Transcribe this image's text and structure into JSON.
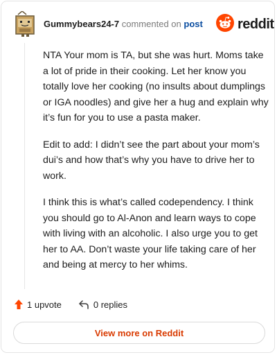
{
  "header": {
    "username": "Gummybears24-7",
    "commented_on_text": "commented on",
    "post_link": "post",
    "brand_name": "reddit"
  },
  "icons": {
    "avatar": "avatar-icon",
    "brand": "reddit-logo-icon",
    "upvote": "upvote-arrow-icon",
    "reply": "reply-arrow-icon"
  },
  "comment": {
    "paragraphs": [
      "NTA Your mom is TA, but she was hurt. Moms take a lot of pride in their cooking. Let her know you totally love her cooking (no insults about dumplings or IGA noodles) and give her a hug and explain why it’s fun for you to use a pasta maker.",
      "Edit to add: I didn’t see the part about your mom’s dui’s and how that’s why you have to drive her to work.",
      "I think this is what’s called codependency. I think you should go to Al-Anon and learn ways to cope with living with an alcoholic. I also urge you to get her to AA. Don’t waste your life taking care of her and being at mercy to her whims."
    ]
  },
  "footer": {
    "upvotes": "1 upvote",
    "replies": "0 replies",
    "view_more": "View more on Reddit"
  },
  "colors": {
    "brand_orange": "#ff4500",
    "link_blue": "#0a4da0",
    "view_more_text": "#d93a00",
    "muted_text": "#7a7a7a",
    "avatar_tan": "#c8a15e"
  }
}
